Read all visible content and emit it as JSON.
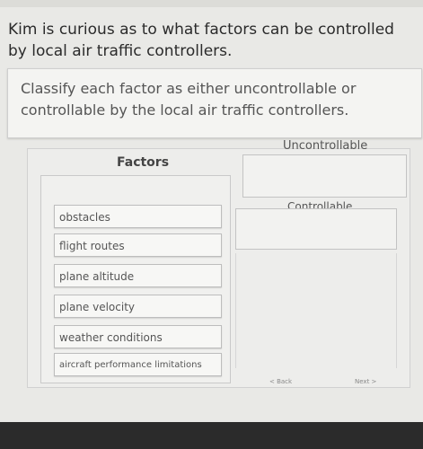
{
  "question": {
    "intro": "Kim is curious as to what factors can be controlled by local air traffic controllers.",
    "instruction": "Classify each factor as either uncontrollable or controllable by the local air traffic controllers."
  },
  "factors": {
    "header": "Factors",
    "items": [
      "obstacles",
      "flight routes",
      "plane altitude",
      "plane velocity",
      "weather conditions",
      "aircraft performance limitations"
    ]
  },
  "categories": {
    "uncontrollable": "Uncontrollable",
    "controllable": "Controllable"
  },
  "nav": {
    "back": "< Back",
    "next": "Next >"
  }
}
